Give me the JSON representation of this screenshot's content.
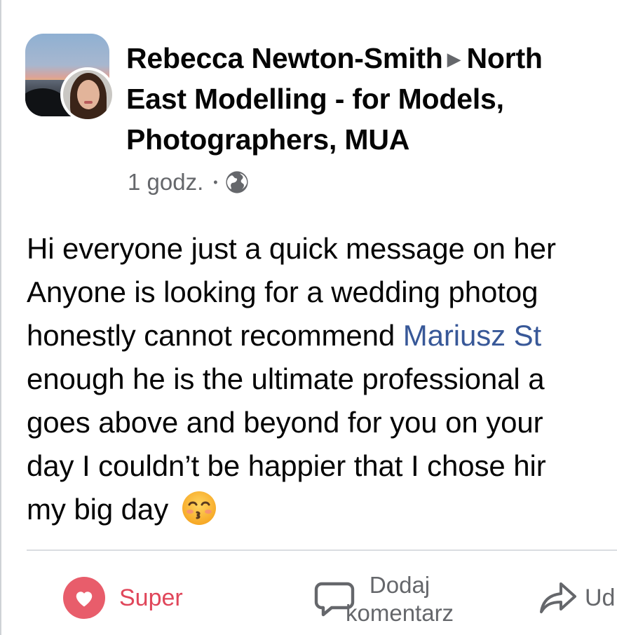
{
  "post": {
    "author": "Rebecca Newton-Smith",
    "group_line1": "North",
    "group_line2": "East Modelling - for Models,",
    "group_line3": "Photographers, MUA",
    "time": "1 godz.",
    "audience_icon": "globe-icon",
    "text_lines": [
      "Hi everyone just a quick message on her",
      "Anyone is looking for a wedding photog",
      "honestly cannot recommend ",
      "enough he is the ultimate professional a",
      "goes above and beyond for you on your",
      "day I couldn’t be happier that I chose hir",
      "my big day"
    ],
    "mention": "Mariusz St",
    "emoji": "kissing-face-emoji"
  },
  "actions": {
    "super_label": "Super",
    "comment_label_1": "Dodaj",
    "comment_label_2": "komentarz",
    "share_label": "Ud"
  },
  "colors": {
    "text": "#050505",
    "secondary": "#65676b",
    "mention": "#385898",
    "reaction": "#e85d6b"
  }
}
